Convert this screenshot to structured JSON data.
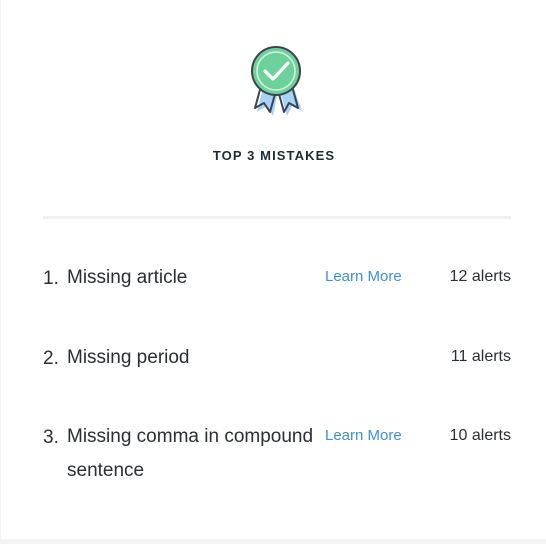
{
  "header": {
    "title": "TOP 3 MISTAKES"
  },
  "mistakes": [
    {
      "number": "1.",
      "label": "Missing article",
      "link": "Learn More",
      "count": "12 alerts"
    },
    {
      "number": "2.",
      "label": "Missing period",
      "link": "",
      "count": "11 alerts"
    },
    {
      "number": "3.",
      "label": "Missing comma in compound sentence",
      "link": "Learn More",
      "count": "10 alerts"
    }
  ],
  "colors": {
    "badge_green": "#6dd19a",
    "badge_ribbon": "#a9d3f5",
    "link": "#3d8fdb",
    "text": "#2a2e35"
  }
}
